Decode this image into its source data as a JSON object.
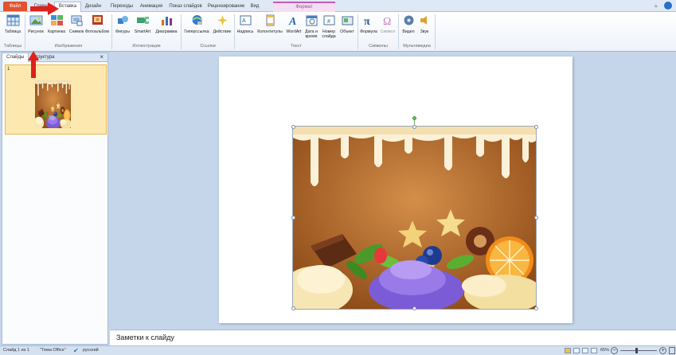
{
  "tabs": {
    "file": "Файл",
    "home": "Главная",
    "insert": "Вставка",
    "design": "Дизайн",
    "transitions": "Переходы",
    "animation": "Анимация",
    "slideshow": "Показ слайдов",
    "review": "Рецензирование",
    "view": "Вид",
    "format": "Формат"
  },
  "ribbon": {
    "table": "Таблица",
    "picture": "Рисунок",
    "clipart": "Картинка",
    "screenshot": "Снимок",
    "photoalbum": "Фотоальбом",
    "shapes": "Фигуры",
    "smartart": "SmartArt",
    "chart": "Диаграмма",
    "hyperlink": "Гиперссылка",
    "action": "Действие",
    "textbox": "Надпись",
    "headerfooter": "Колонтитулы",
    "wordart": "WordArt",
    "datetime_1": "Дата и",
    "datetime_2": "время",
    "slidenum_1": "Номер",
    "slidenum_2": "слайда",
    "object": "Объект",
    "equation": "Формула",
    "symbol": "Символ",
    "video": "Видео",
    "audio": "Звук"
  },
  "groups": {
    "tables": "Таблицы",
    "images": "Изображения",
    "illustrations": "Иллюстрации",
    "links": "Ссылки",
    "text": "Текст",
    "symbols": "Символы",
    "media": "Мультимедиа"
  },
  "pane": {
    "slides_tab": "Слайды",
    "outline_tab": "Структура",
    "close": "×",
    "thumb_number": "1"
  },
  "notes_placeholder": "Заметки к слайду",
  "status": {
    "slide": "Слайд 1 из 1",
    "theme": "\"Тема Office\"",
    "language": "русский",
    "zoom": "65%"
  },
  "colors": {
    "accent_file": "#e4512c",
    "context_tab": "#c55ab4",
    "arrow": "#e0201b"
  }
}
